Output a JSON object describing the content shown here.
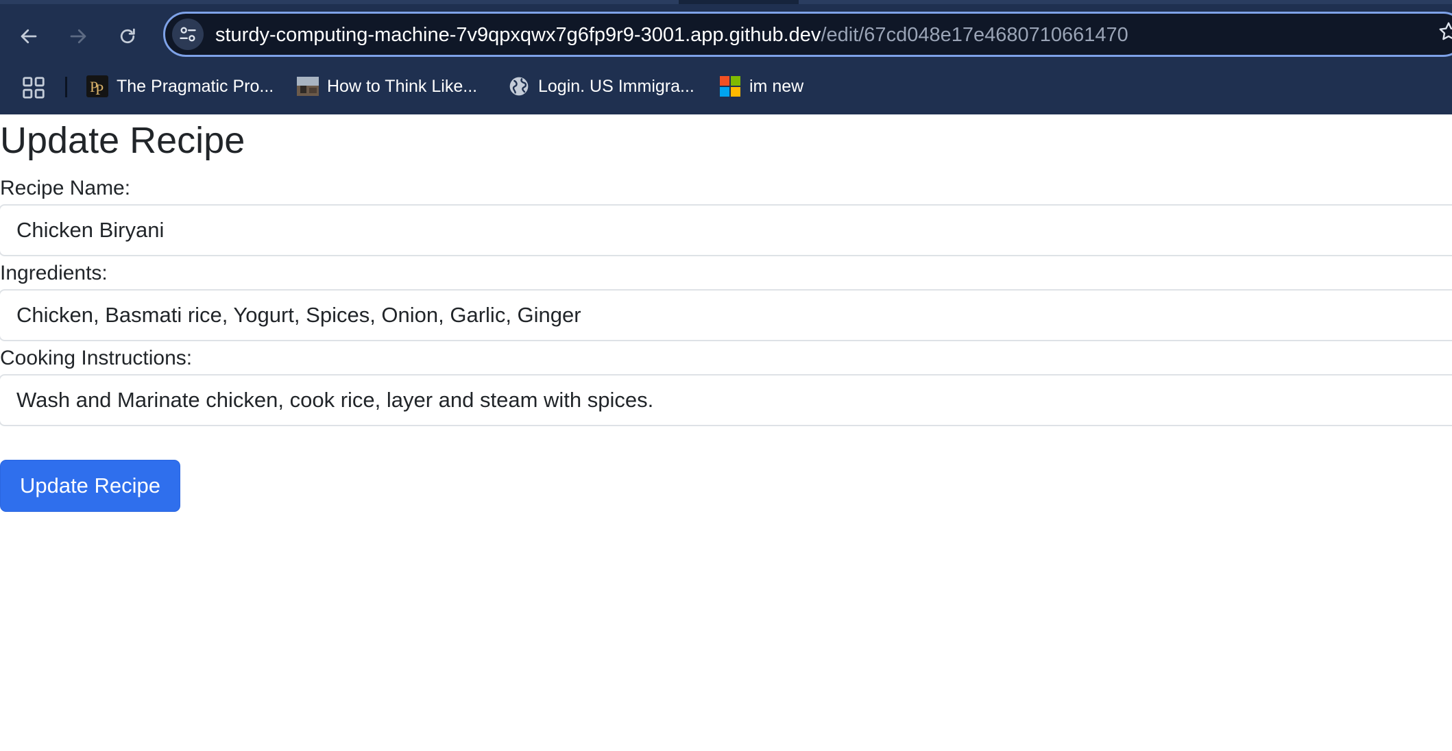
{
  "browser": {
    "url_host": "sturdy-computing-machine-7v9qpxqwx7g6fp9r9-3001.app.github.dev",
    "url_path": "/edit/67cd048e17e4680710661470",
    "bookmarks": [
      {
        "label": "The Pragmatic Pro...",
        "icon": "pragmatic-programmer-favicon"
      },
      {
        "label": "How to Think Like...",
        "icon": "book-thumbnail-favicon"
      },
      {
        "label": "Login. US Immigra...",
        "icon": "globe-icon"
      },
      {
        "label": "im new",
        "icon": "microsoft-logo-icon"
      }
    ]
  },
  "page": {
    "title": "Update Recipe",
    "fields": [
      {
        "label": "Recipe Name:",
        "value": "Chicken Biryani"
      },
      {
        "label": "Ingredients:",
        "value": "Chicken, Basmati rice, Yogurt, Spices, Onion, Garlic, Ginger"
      },
      {
        "label": "Cooking Instructions:",
        "value": "Wash and Marinate chicken, cook rice, layer and steam with spices."
      }
    ],
    "submit_label": "Update Recipe"
  },
  "colors": {
    "chrome_background": "#1f3050",
    "omnibox_border": "#7ea2e8",
    "primary_button": "#2f6fed",
    "text": "#212529"
  }
}
